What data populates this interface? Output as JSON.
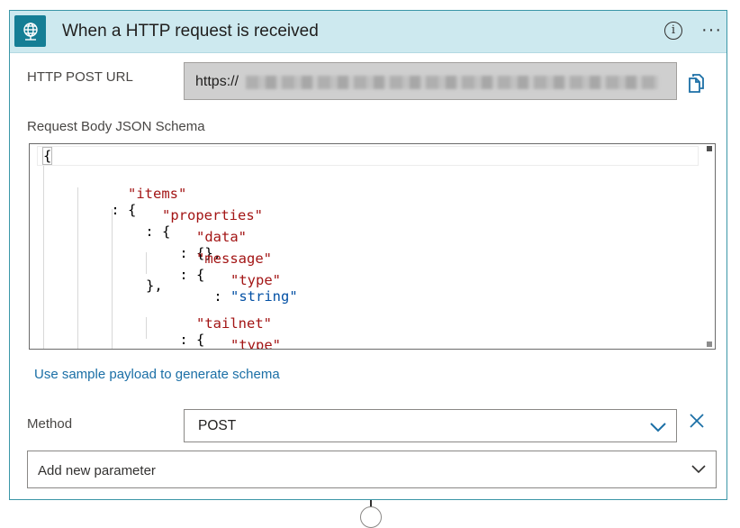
{
  "header": {
    "title": "When a HTTP request is received",
    "trigger_icon": "globe-request-icon",
    "info_icon": "info-icon",
    "info_glyph": "i",
    "more_icon": "ellipsis-icon",
    "more_glyph": "···"
  },
  "url": {
    "label": "HTTP POST URL",
    "prefix": "https://",
    "copy_icon": "copy-icon"
  },
  "schema": {
    "label": "Request Body JSON Schema",
    "lines": [
      "{",
      "\"items\": {",
      "\"properties\": {",
      "\"data\": {},",
      "\"message\": {",
      "\"type\": \"string\"",
      "},",
      "\"tailnet\": {",
      "\"type\": \"string\""
    ]
  },
  "sample_link": "Use sample payload to generate schema",
  "method": {
    "label": "Method",
    "value": "POST",
    "chevron_icon": "chevron-down-icon",
    "remove_icon": "close-icon"
  },
  "add_parameter": {
    "placeholder": "Add new parameter",
    "chevron_icon": "chevron-down-icon"
  },
  "colors": {
    "header_bg": "#cde9ef",
    "icon_bg": "#157e95",
    "accent": "#1b6fa6",
    "key_color": "#a31515",
    "string_color": "#0451a5"
  }
}
